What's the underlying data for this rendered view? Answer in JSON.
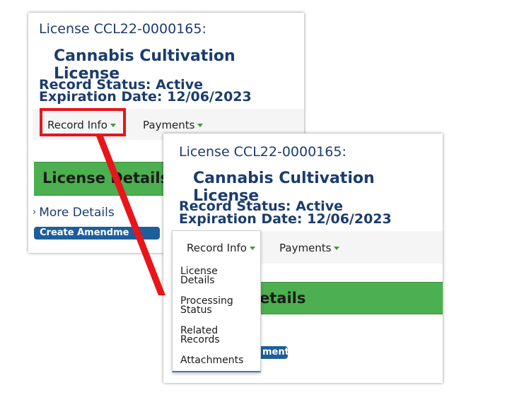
{
  "record": {
    "license_label": "License CCL22-0000165:",
    "license_type": "Cannabis Cultivation License",
    "record_status": "Record Status: Active",
    "expiration": "Expiration Date: 12/06/2023"
  },
  "tabs": {
    "record_info": "Record Info",
    "payments": "Payments"
  },
  "section": {
    "title_back": "License Details",
    "title_front": "etails",
    "more_details": "More Details",
    "create_amendment_back": "Create Amendme",
    "create_amendment_front": "ment"
  },
  "dropdown": {
    "items": [
      {
        "line1": "License",
        "line2": "Details"
      },
      {
        "line1": "Processing",
        "line2": "Status"
      },
      {
        "line1": "Related",
        "line2": "Records"
      },
      {
        "line1": "Attachments",
        "line2": ""
      }
    ]
  },
  "colors": {
    "title_navy": "#1b3c6e",
    "section_green": "#4caf50",
    "button_blue": "#1d5e9b",
    "highlight_red": "#e8151b",
    "caret_green": "#3a9b3a"
  }
}
